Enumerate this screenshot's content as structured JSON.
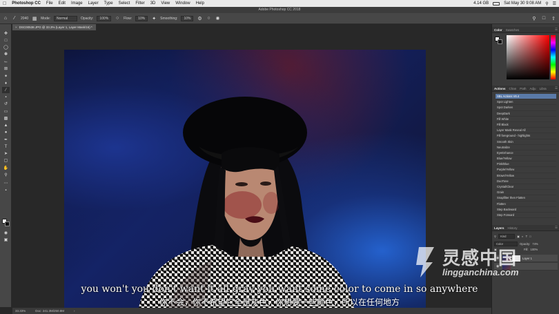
{
  "menubar": {
    "app_name": "Photoshop CC",
    "items": [
      "File",
      "Edit",
      "Image",
      "Layer",
      "Type",
      "Select",
      "Filter",
      "3D",
      "View",
      "Window",
      "Help"
    ],
    "battery": "4.14 GB",
    "datetime": "Sat May 30  9:08 AM"
  },
  "titlebar": {
    "title": "Adobe Photoshop CC 2018"
  },
  "options": {
    "mode_label": "Mode:",
    "mode_value": "Normal",
    "opacity_label": "Opacity:",
    "opacity_value": "100%",
    "flow_label": "Flow:",
    "flow_value": "10%",
    "smoothing_label": "Smoothing:",
    "smoothing_value": "10%",
    "brush_size": "2040"
  },
  "document": {
    "tab_title": "DSC00538.JPG @ 33.3% (Layer 1, Layer Mask/16) *"
  },
  "status": {
    "zoom": "33.33%",
    "doc_info": "Doc: 241.3M/250.8M"
  },
  "panels": {
    "color_tabs": [
      "Color",
      "Swatches"
    ],
    "actions_tabs": [
      "Actions",
      "Chan",
      "Path",
      "Adju",
      "Libra"
    ],
    "actions": [
      "SBL Actions V8.4",
      "Spot Lighten",
      "Spot Darken",
      "DeepDark",
      "Fill White",
      "Fill Black",
      "Layer Mask Reveal All",
      "Fill foreground - highlights",
      "Smooth Skin",
      "Neutralize",
      "EyeEnhance",
      "Blue/Yellow",
      "Pink/Blue",
      "Purple/Yellow",
      "Brown/Yellow",
      "DuoTone",
      "Crystal/Clear",
      "Grain",
      "Snapfilter then Flatten",
      "Flatten",
      "Step Backward",
      "Step Forward"
    ],
    "layers_tabs": [
      "Layers",
      "History"
    ],
    "kind_label": "Kind",
    "blend_mode": "Color",
    "opacity_label": "Opacity:",
    "opacity_value": "74%",
    "fill_label": "Fill:",
    "fill_value": "100%",
    "layer_name": "Layer 1"
  },
  "subtitles": {
    "en": "you won't you don't want it all gray you want some color to come in so anywhere",
    "zh": "你不会，你不希望它全是灰色，你想要一些颜色，所以在任何地方"
  },
  "watermark": {
    "brand_cn": "灵感中国",
    "url": "lingganchina.com"
  }
}
